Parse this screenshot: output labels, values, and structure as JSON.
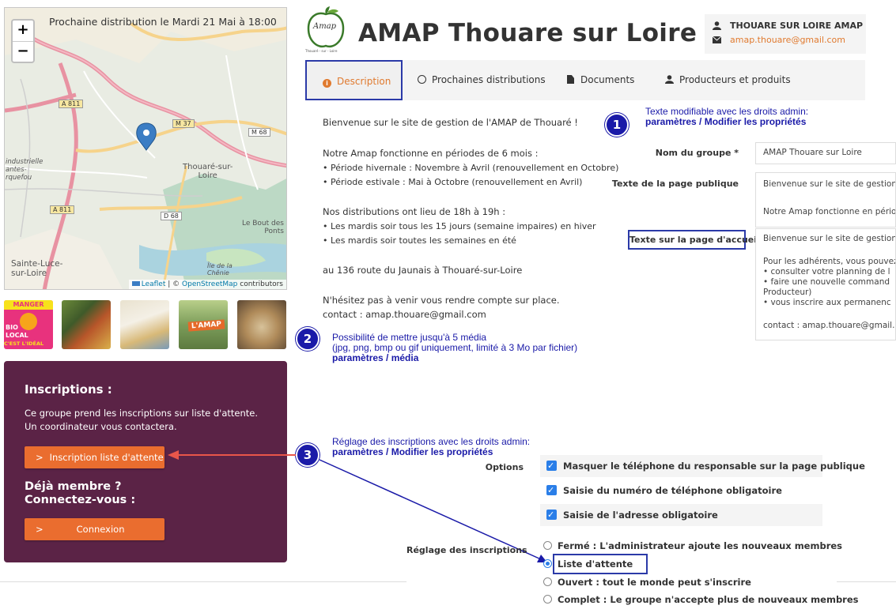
{
  "map": {
    "title": "Prochaine distribution le Mardi 21 Mai à 18:00",
    "zoom_in": "+",
    "zoom_out": "−",
    "attribution_leaflet": "Leaflet",
    "attribution_sep": " | © ",
    "attribution_osm": "OpenStreetMap",
    "attribution_tail": " contributors",
    "labels": {
      "thouare": "Thouaré-sur-\nLoire",
      "sainte_luce": "Sainte-Luce-\nsur-Loire",
      "le_bout_des_ponts": "Le Bout des\nPonts",
      "industrielle": "industrielle\nantes-\nrquefou",
      "ile_de_la_chenie": "Île de la\nChênie"
    },
    "roads": [
      "A 811",
      "A 811",
      "M 37",
      "M 68",
      "D 68"
    ]
  },
  "thumbnails": [
    {
      "name": "manger-bio-local-thumbnail",
      "text": [
        "MANGER",
        "BIO",
        "LOCAL",
        "C'EST L'IDÉAL"
      ]
    },
    {
      "name": "vegetables-thumbnail"
    },
    {
      "name": "products-thumbnail"
    },
    {
      "name": "amap-board-thumbnail",
      "text": [
        "L'AMAP"
      ]
    },
    {
      "name": "bread-thumbnail"
    }
  ],
  "inscriptions": {
    "title": "Inscriptions :",
    "text": "Ce groupe prend les inscriptions sur liste d'attente. Un coordinateur vous contactera.",
    "waitlist_button": "Inscription liste d'attente",
    "member_title": "Déjà membre ?\nConnectez-vous :",
    "login_button": "Connexion",
    "chevron": ">"
  },
  "header": {
    "logo_text": "Amap",
    "logo_subtext": "Thouaré - sur - Loire",
    "title": "AMAP Thouare sur Loire",
    "contact_name": "THOUARE SUR LOIRE AMAP",
    "contact_email": "amap.thouare@gmail.com"
  },
  "tabs": [
    {
      "label": "Description",
      "icon": "info-icon",
      "active": true
    },
    {
      "label": "Prochaines distributions",
      "icon": "clock-icon",
      "active": false
    },
    {
      "label": "Documents",
      "icon": "document-icon",
      "active": false
    },
    {
      "label": "Producteurs et produits",
      "icon": "user-icon",
      "active": false
    }
  ],
  "description": {
    "welcome": "Bienvenue sur le site de gestion de l'AMAP de Thouaré !",
    "p1_l1": "Notre Amap fonctionne en périodes de 6 mois :",
    "p1_l2": "• Période hivernale : Novembre à Avril (renouvellement en Octobre)",
    "p1_l3": "• Période estivale : Mai à Octobre (renouvellement en Avril)",
    "p2_l1": "Nos distributions ont lieu de 18h à 19h :",
    "p2_l2": "• Les mardis soir tous les 15 jours (semaine impaires) en hiver",
    "p2_l3": "• Les mardis soir toutes les semaines en été",
    "address": "au 136 route du Jaunais à Thouaré-sur-Loire",
    "visit": "N'hésitez pas à venir vous rendre compte sur place.",
    "contact": "contact : amap.thouare@gmail.com"
  },
  "form": {
    "group_name_label": "Nom du groupe *",
    "group_name_value": "AMAP Thouare sur Loire",
    "public_text_label": "Texte de la page publique",
    "public_text_l1": "Bienvenue sur le site de gestion c",
    "public_text_l2": "Notre Amap fonctionne en pério",
    "home_text_label": "Texte sur la page d'accueil",
    "home_l1": "Bienvenue sur le site de gestion c",
    "home_l2": "Pour les adhérents,  vous pouvez",
    "home_l3": "•     consulter votre planning de l",
    "home_l4": "•     faire une nouvelle command",
    "home_l5": "Producteur)",
    "home_l6": "•     vous inscrire aux permanenc",
    "home_l7": "contact : amap.thouare@gmail.co"
  },
  "callouts": {
    "c1_num": "1",
    "c1_l1": "Texte modifiable avec les droits admin:",
    "c1_l2": "paramètres / Modifier les propriétés",
    "c2_num": "2",
    "c2_l1": "Possibilité de mettre jusqu'à 5 média",
    "c2_l2": " (jpg, png, bmp ou gif uniquement, limité à 3 Mo par fichier)",
    "c2_l3": "paramètres / média",
    "c3_num": "3",
    "c3_l1": "Réglage des inscriptions avec les droits admin:",
    "c3_l2": "paramètres / Modifier les propriétés"
  },
  "options": {
    "label": "Options",
    "items": [
      "Masquer le téléphone du responsable sur la page publique",
      "Saisie du numéro de téléphone obligatoire",
      "Saisie de l'adresse obligatoire"
    ]
  },
  "registration": {
    "label": "Réglage des inscriptions",
    "choices": [
      "Fermé : L'administrateur ajoute les nouveaux membres",
      "Liste d'attente",
      "Ouvert : tout le monde peut s'inscrire",
      "Complet : Le groupe n'accepte plus de nouveaux membres"
    ],
    "selected_index": 1
  },
  "colors": {
    "brand_orange": "#ea6d2f",
    "panel_purple": "#5b2346",
    "callout_blue": "#1a1aa8",
    "checkbox_blue": "#2a7ee8"
  }
}
